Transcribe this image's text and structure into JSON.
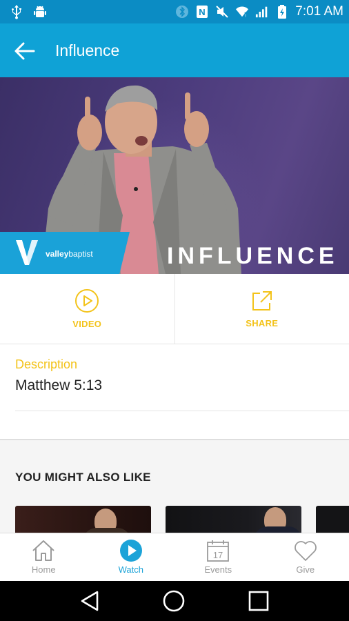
{
  "status_bar": {
    "time": "7:01 AM",
    "icons": [
      "usb-icon",
      "android-icon",
      "bluetooth-icon",
      "nfc-icon",
      "mute-icon",
      "wifi-icon",
      "signal-icon",
      "battery-icon"
    ]
  },
  "app_bar": {
    "title": "Influence",
    "back_icon": "arrow-left-icon"
  },
  "hero": {
    "title": "INFLUENCE",
    "logo_text_bold": "valley",
    "logo_text_light": "baptist"
  },
  "actions": [
    {
      "label": "VIDEO",
      "icon": "play-circle-icon"
    },
    {
      "label": "SHARE",
      "icon": "share-external-icon"
    }
  ],
  "description": {
    "label": "Description",
    "value": "Matthew 5:13"
  },
  "related": {
    "title": "YOU MIGHT ALSO LIKE"
  },
  "bottom_nav": [
    {
      "label": "Home",
      "icon": "home-icon",
      "active": false
    },
    {
      "label": "Watch",
      "icon": "play-circle-filled-icon",
      "active": true
    },
    {
      "label": "Events",
      "icon": "calendar-icon",
      "active": false,
      "calendar_day": "17"
    },
    {
      "label": "Give",
      "icon": "heart-icon",
      "active": false
    }
  ],
  "colors": {
    "status_bar": "#0b8cc4",
    "app_bar": "#0fa2d6",
    "accent_yellow": "#f3c31a",
    "active_blue": "#1ca3d8",
    "inactive_gray": "#9a9a9a"
  }
}
